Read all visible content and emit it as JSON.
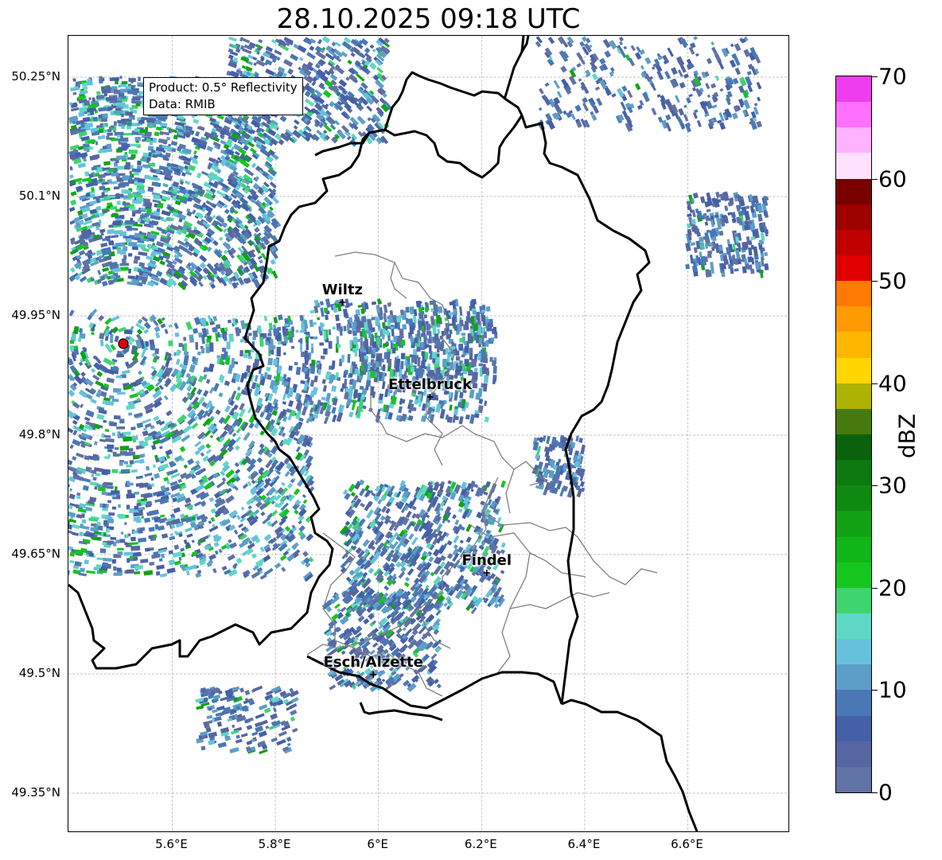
{
  "title": "28.10.2025 09:18 UTC",
  "info": {
    "product": "Product: 0.5° Reflectivity",
    "data": "Data: RMIB"
  },
  "y_ticks": [
    "50.25°N",
    "50.1°N",
    "49.95°N",
    "49.8°N",
    "49.65°N",
    "49.5°N",
    "49.35°N"
  ],
  "x_ticks": [
    "5.6°E",
    "5.8°E",
    "6°E",
    "6.2°E",
    "6.4°E",
    "6.6°E"
  ],
  "cities": [
    {
      "name": "Wiltz",
      "lon": 5.93,
      "lat": 49.967
    },
    {
      "name": "Ettelbruck",
      "lon": 6.1,
      "lat": 49.848
    },
    {
      "name": "Findel",
      "lon": 6.21,
      "lat": 49.627
    },
    {
      "name": "Esch/Alzette",
      "lon": 5.99,
      "lat": 49.499
    }
  ],
  "radar_site": {
    "lon": 5.505,
    "lat": 49.915,
    "color": "#e00000"
  },
  "colorbar": {
    "label": "dBZ",
    "ticks": [
      "0",
      "10",
      "20",
      "30",
      "40",
      "50",
      "60",
      "70"
    ],
    "colors": [
      "#6072a6",
      "#5566a3",
      "#4460a8",
      "#4a78b4",
      "#5d9ec8",
      "#66c2dc",
      "#5ed8c4",
      "#3ed46e",
      "#14c61e",
      "#10b618",
      "#10a214",
      "#0e8a10",
      "#0c7a0e",
      "#0a620c",
      "#467a0e",
      "#aeb200",
      "#ffd600",
      "#ffb600",
      "#ff9a00",
      "#ff7a00",
      "#e00000",
      "#c00000",
      "#9e0000",
      "#7a0000",
      "#ffe0ff",
      "#ffb2ff",
      "#ff70ff",
      "#ee3cee"
    ]
  }
}
